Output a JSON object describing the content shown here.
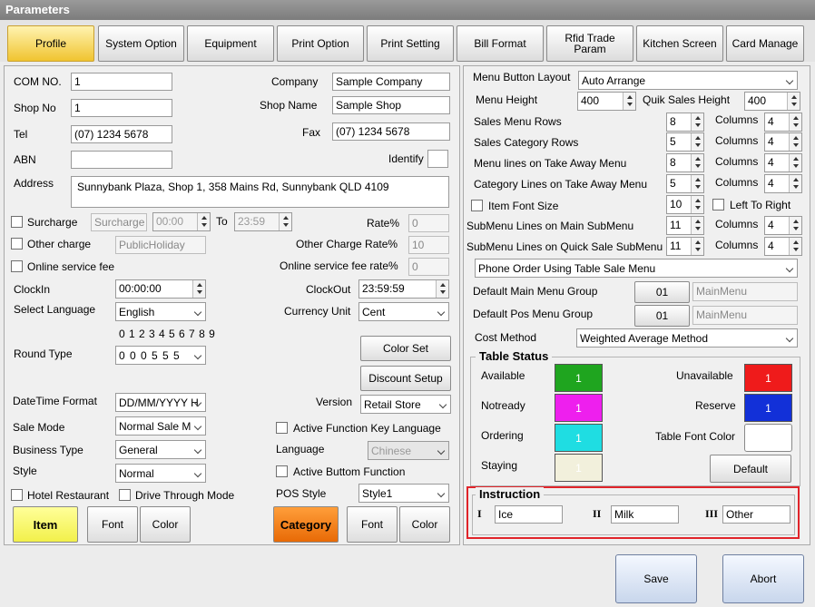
{
  "window": {
    "title": "Parameters"
  },
  "tabs": [
    "Profile",
    "System Option",
    "Equipment",
    "Print Option",
    "Print Setting",
    "Bill Format",
    "Rfid Trade\nParam",
    "Kitchen Screen",
    "Card Manage"
  ],
  "profile": {
    "com_no_label": "COM NO.",
    "com_no": "1",
    "shop_no_label": "Shop No",
    "shop_no": "1",
    "tel_label": "Tel",
    "tel": "(07) 1234 5678",
    "abn_label": "ABN",
    "abn": "",
    "address_label": "Address",
    "address": "Sunnybank Plaza, Shop 1, 358 Mains Rd, Sunnybank QLD 4109",
    "company_label": "Company",
    "company": "Sample Company",
    "shop_name_label": "Shop Name",
    "shop_name": "Sample Shop",
    "fax_label": "Fax",
    "fax": "(07) 1234 5678",
    "identify_label": "Identify",
    "surcharge_label": "Surcharge",
    "surcharge_placeholder": "Surcharge",
    "surcharge_from": "00:00",
    "to_label": "To",
    "surcharge_to": "23:59",
    "rate_label": "Rate%",
    "rate": "0",
    "other_charge_label": "Other charge",
    "other_charge_placeholder": "PublicHoliday",
    "other_rate_label": "Other Charge Rate%",
    "other_rate": "10",
    "online_fee_label": "Online service fee",
    "online_rate_label": "Online service fee rate%",
    "online_rate": "0",
    "clockin_label": "ClockIn",
    "clockin": "00:00:00",
    "clockout_label": "ClockOut",
    "clockout": "23:59:59",
    "language_label": "Select Language",
    "language": "English",
    "currency_label": "Currency Unit",
    "currency": "Cent",
    "digits": "0 1 2 3 4 5 6 7 8 9",
    "round_label": "Round Type",
    "round": "0 0 0 5 5 5",
    "color_set": "Color Set",
    "discount_setup": "Discount Setup",
    "datetime_label": "DateTime Format",
    "datetime": "DD/MM/YYYY H",
    "version_label": "Version",
    "version": "Retail Store",
    "sale_mode_label": "Sale Mode",
    "sale_mode": "Normal Sale M",
    "active_fn_lang": "Active Function Key Language",
    "business_label": "Business Type",
    "business": "General",
    "lang2_label": "Language",
    "lang2": "Chinese",
    "style_label": "Style",
    "style": "Normal",
    "active_bottom": "Active Buttom Function",
    "hotel": "Hotel Restaurant",
    "drive": "Drive Through Mode",
    "pos_style_label": "POS Style",
    "pos_style": "Style1",
    "item_btn": "Item",
    "font_btn": "Font",
    "color_btn": "Color",
    "category_btn": "Category"
  },
  "menu": {
    "layout_label": "Menu Button Layout",
    "layout": "Auto Arrange",
    "height_label": "Menu Height",
    "height": "400",
    "quik_label": "Quik Sales Height",
    "quik": "400",
    "rows": [
      {
        "label": "Sales Menu Rows",
        "value": "8",
        "cols": "4"
      },
      {
        "label": "Sales Category Rows",
        "value": "5",
        "cols": "4"
      },
      {
        "label": "Menu lines on Take Away Menu",
        "value": "8",
        "cols": "4"
      },
      {
        "label": "Category Lines on Take Away Menu",
        "value": "5",
        "cols": "4"
      }
    ],
    "columns_label": "Columns",
    "item_font_label": "Item Font Size",
    "item_font": "10",
    "left_to_right": "Left To Right",
    "sub_main_label": "SubMenu Lines on Main SubMenu",
    "sub_main": "11",
    "sub_main_cols": "4",
    "sub_quick_label": "SubMenu Lines on Quick Sale SubMenu",
    "sub_quick": "11",
    "sub_quick_cols": "4",
    "phone_order": "Phone Order Using Table Sale Menu",
    "main_group_label": "Default Main Menu Group",
    "main_group_no": "01",
    "main_group": "MainMenu",
    "pos_group_label": "Default Pos Menu Group",
    "pos_group_no": "01",
    "pos_group": "MainMenu",
    "cost_label": "Cost Method",
    "cost": "Weighted Average Method"
  },
  "table_status": {
    "title": "Table Status",
    "available": "Available",
    "unavailable": "Unavailable",
    "notready": "Notready",
    "reserve": "Reserve",
    "ordering": "Ordering",
    "font_color": "Table Font Color",
    "staying": "Staying",
    "default_btn": "Default",
    "value": "1",
    "colors": {
      "available": "#1fa51f",
      "unavailable": "#ef1b1b",
      "notready": "#ee1fee",
      "reserve": "#1230d8",
      "ordering": "#1fdde2",
      "staying": "#f2f0dc",
      "font": "#ffffff"
    }
  },
  "instruction": {
    "title": "Instruction",
    "items": [
      {
        "num": "I",
        "value": "Ice"
      },
      {
        "num": "II",
        "value": "Milk"
      },
      {
        "num": "III",
        "value": "Other"
      }
    ]
  },
  "footer": {
    "save": "Save",
    "abort": "Abort"
  }
}
